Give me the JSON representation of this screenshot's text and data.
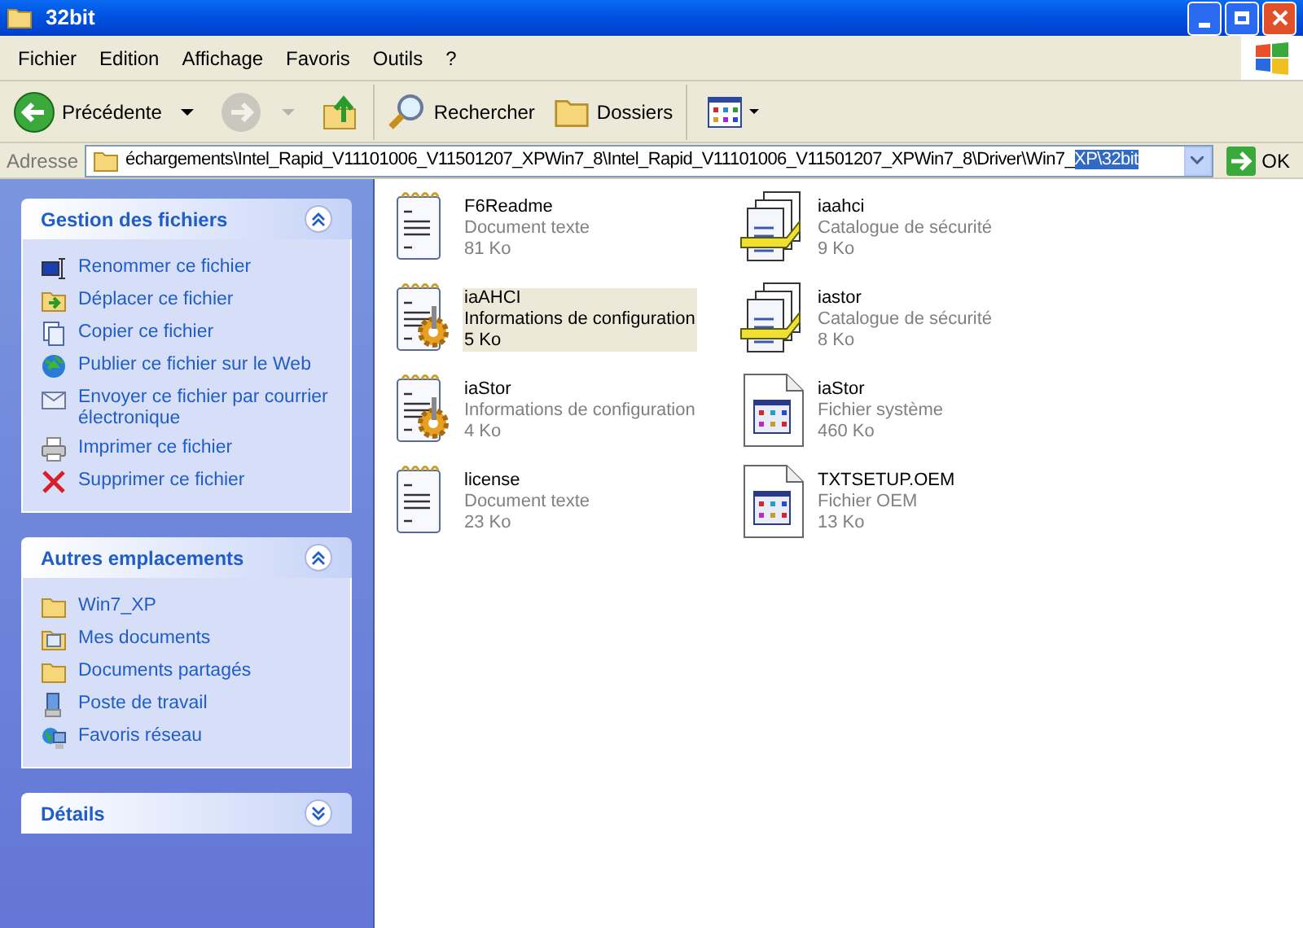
{
  "window": {
    "title": "32bit"
  },
  "menu": [
    "Fichier",
    "Edition",
    "Affichage",
    "Favoris",
    "Outils",
    "?"
  ],
  "toolbar": [
    {
      "kind": "back",
      "label": "Précédente",
      "disabled": false
    },
    {
      "kind": "forward",
      "disabled": true
    },
    {
      "kind": "up",
      "disabled": false
    },
    {
      "kind": "search",
      "label": "Rechercher",
      "disabled": false
    },
    {
      "kind": "folders",
      "label": "Dossiers",
      "disabled": false
    },
    {
      "kind": "views",
      "disabled": false
    }
  ],
  "address": {
    "label": "Adresse",
    "value": "échargements\\Intel_Rapid_V11101006_V11501207_XPWin7_8\\Intel_Rapid_V11101006_V11501207_XPWin7_8\\Driver\\Win7_",
    "selection": "XP\\32bit",
    "go": "OK"
  },
  "sidebar": [
    {
      "title": "Gestion des fichiers",
      "expanded": true,
      "items": [
        {
          "kind": "rename",
          "label": "Renommer ce fichier"
        },
        {
          "kind": "move",
          "label": "Déplacer ce fichier"
        },
        {
          "kind": "copy",
          "label": "Copier ce fichier"
        },
        {
          "kind": "web",
          "label": "Publier ce fichier sur le Web"
        },
        {
          "kind": "mail",
          "label": "Envoyer ce fichier par courrier électronique"
        },
        {
          "kind": "print",
          "label": "Imprimer ce fichier"
        },
        {
          "kind": "delete",
          "label": "Supprimer ce fichier"
        }
      ]
    },
    {
      "title": "Autres emplacements",
      "expanded": true,
      "items": [
        {
          "kind": "folder",
          "label": "Win7_XP"
        },
        {
          "kind": "documents",
          "label": "Mes documents"
        },
        {
          "kind": "folder",
          "label": "Documents partagés"
        },
        {
          "kind": "computer",
          "label": "Poste de travail"
        },
        {
          "kind": "network",
          "label": "Favoris réseau"
        }
      ]
    },
    {
      "title": "Détails",
      "expanded": false
    }
  ],
  "files": [
    {
      "kind": "text",
      "name": "F6Readme",
      "type": "Document texte",
      "size": "81 Ko",
      "selected": false
    },
    {
      "kind": "catalog",
      "name": "iaahci",
      "type": "Catalogue de sécurité",
      "size": "9 Ko",
      "selected": false
    },
    {
      "kind": "inf",
      "name": "iaAHCI",
      "type": "Informations de configuration",
      "size": "5 Ko",
      "selected": true
    },
    {
      "kind": "catalog",
      "name": "iastor",
      "type": "Catalogue de sécurité",
      "size": "8 Ko",
      "selected": false
    },
    {
      "kind": "inf",
      "name": "iaStor",
      "type": "Informations de configuration",
      "size": "4 Ko",
      "selected": false
    },
    {
      "kind": "system",
      "name": "iaStor",
      "type": "Fichier système",
      "size": "460 Ko",
      "selected": false
    },
    {
      "kind": "text",
      "name": "license",
      "type": "Document texte",
      "size": "23 Ko",
      "selected": false
    },
    {
      "kind": "system",
      "name": "TXTSETUP.OEM",
      "type": "Fichier OEM",
      "size": "13 Ko",
      "selected": false
    }
  ]
}
